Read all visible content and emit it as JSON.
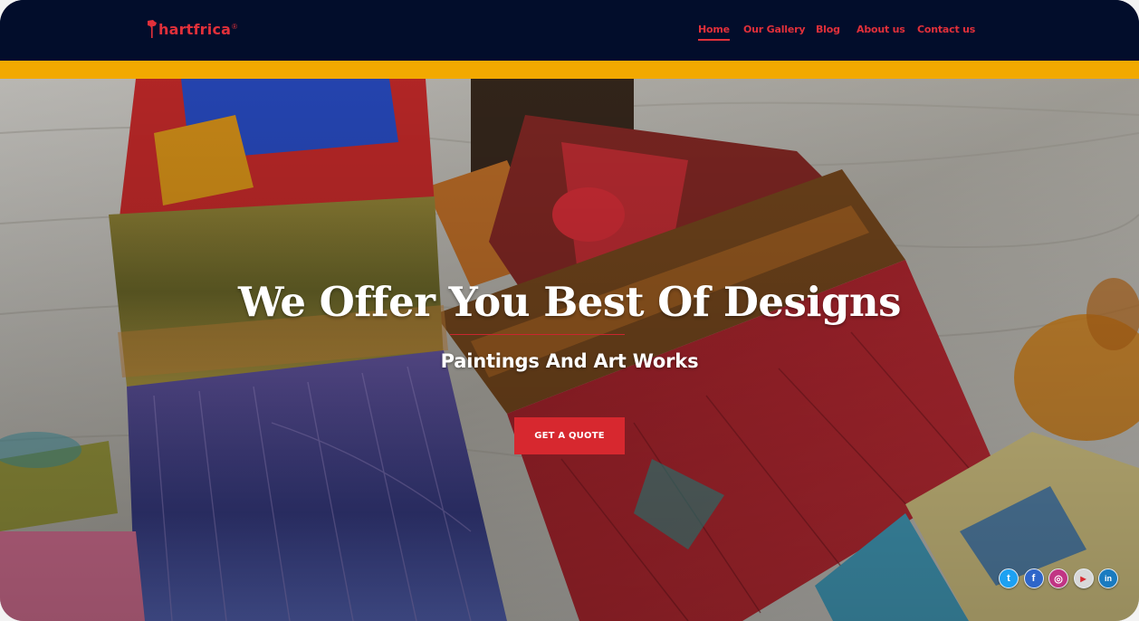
{
  "brand": {
    "name": "hartfrica",
    "color": "#e1303a"
  },
  "nav": {
    "items": [
      {
        "label": "Home",
        "active": true
      },
      {
        "label": "Our Gallery",
        "active": false
      },
      {
        "label": "Blog",
        "active": false
      },
      {
        "label": "About us",
        "active": false
      },
      {
        "label": "Contact us",
        "active": false
      }
    ]
  },
  "hero": {
    "headline": "We Offer You Best Of Designs",
    "subheadline": "Paintings And Art Works",
    "cta_label": "GET A QUOTE",
    "background": "paint-brushes-photo"
  },
  "social": {
    "items": [
      {
        "icon": "twitter-icon",
        "glyph": "t",
        "color": "#1da1f2"
      },
      {
        "icon": "facebook-icon",
        "glyph": "f",
        "color": "#2f66c9"
      },
      {
        "icon": "instagram-icon",
        "glyph": "◎",
        "color": "#c13584"
      },
      {
        "icon": "youtube-icon",
        "glyph": "▶",
        "color": "#d8d8d8"
      },
      {
        "icon": "linkedin-icon",
        "glyph": "in",
        "color": "#1a7bc0"
      }
    ]
  },
  "colors": {
    "navbar": "#020d2b",
    "accent_bar": "#f2a900",
    "brand_red": "#e1303a",
    "cta": "#d7282f"
  }
}
